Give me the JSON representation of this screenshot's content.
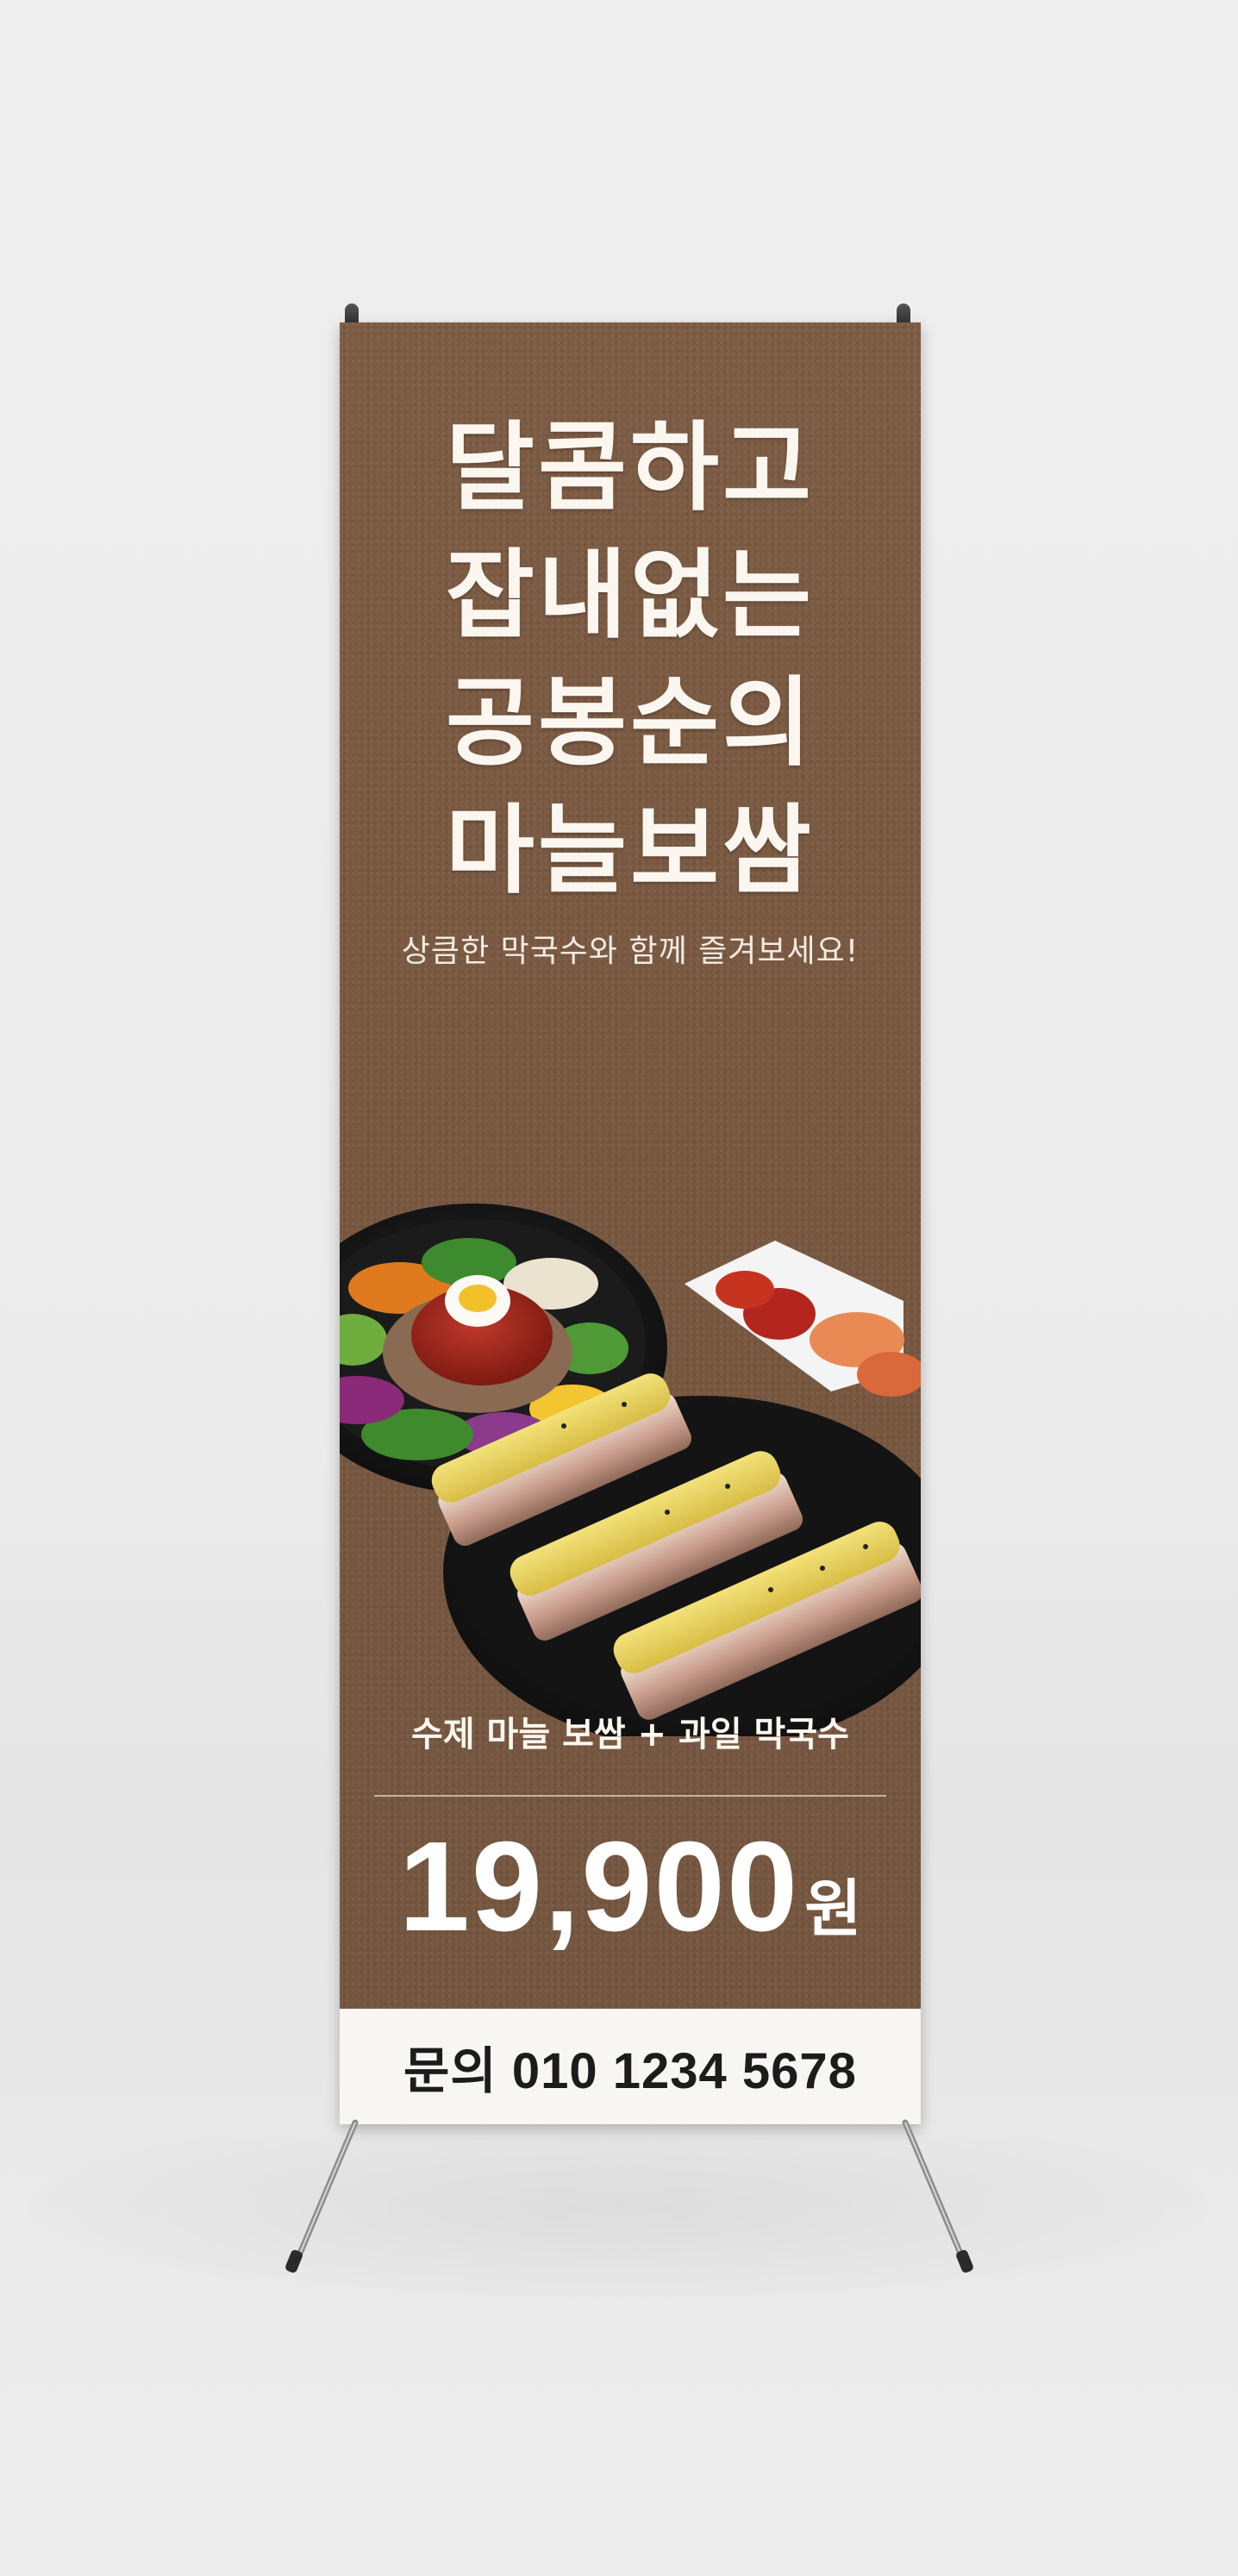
{
  "banner": {
    "headline": [
      "달콤하고",
      "잡내없는",
      "공봉순의",
      "마늘보쌈"
    ],
    "subline": "상큼한 막국수와 함께 즐겨보세요!",
    "menu": "수제 마늘 보쌈 + 과일 막국수",
    "price_number": "19,900",
    "price_unit": "원",
    "contact": "문의 010 1234 5678"
  },
  "colors": {
    "banner_bg": "#7b5a42",
    "text_light": "#fbf7f0",
    "contact_bg": "#f8f6f2",
    "contact_text": "#1c1c1c"
  },
  "images": {
    "food": "bossam-and-makguksu-photo"
  }
}
